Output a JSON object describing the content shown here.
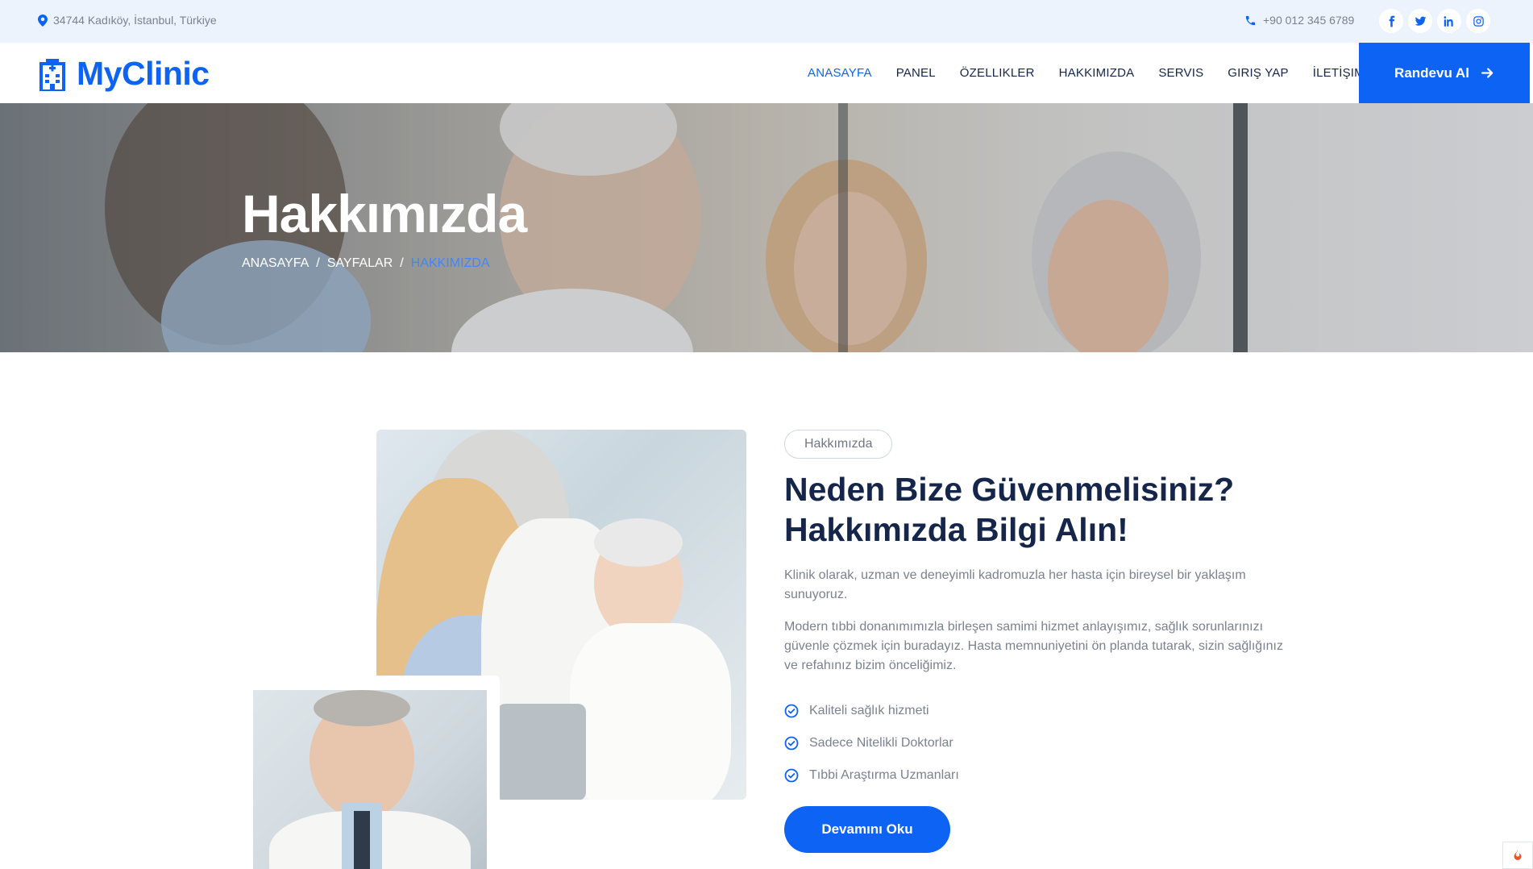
{
  "topbar": {
    "address": "34744 Kadıköy, İstanbul, Türkiye",
    "phone": "+90 012 345 6789",
    "socials": [
      {
        "icon": "facebook-icon",
        "glyph": "f"
      },
      {
        "icon": "twitter-icon",
        "glyph": ""
      },
      {
        "icon": "linkedin-icon",
        "glyph": "in"
      },
      {
        "icon": "instagram-icon",
        "glyph": ""
      }
    ]
  },
  "brand": {
    "name": "MyClinic",
    "icon": "hospital-icon"
  },
  "nav": {
    "items": [
      "ANASAYFA",
      "PANEL",
      "ÖZELLIKLER",
      "HAKKIMIZDA",
      "SERVIS",
      "GIRIŞ YAP",
      "İLETİŞIM"
    ],
    "active_index": 0,
    "cta_label": "Randevu Al"
  },
  "hero": {
    "title": "Hakkımızda",
    "breadcrumb": [
      "ANASAYFA",
      "SAYFALAR",
      "HAKKIMIZDA"
    ],
    "separator": "/"
  },
  "about": {
    "tag": "Hakkımızda",
    "heading_line1": "Neden Bize Güvenmelisiniz?",
    "heading_line2": "Hakkımızda Bilgi Alın!",
    "paragraph1": "Klinik olarak, uzman ve deneyimli kadromuzla her hasta için bireysel bir yaklaşım sunuyoruz.",
    "paragraph2": "Modern tıbbi donanımımızla birleşen samimi hizmet anlayışımız, sağlık sorunlarınızı güvenle çözmek için buradayız. Hasta memnuniyetini ön planda tutarak, sizin sağlığınız ve refahınız bizim önceliğimiz.",
    "checklist": [
      "Kaliteli sağlık hizmeti",
      "Sadece Nitelikli Doktorlar",
      "Tıbbi Araştırma Uzmanları"
    ],
    "read_more": "Devamını Oku"
  },
  "colors": {
    "primary": "#0d63f3",
    "heading": "#15264a",
    "muted": "#7a8190",
    "topbar_bg": "#edf3fc"
  }
}
